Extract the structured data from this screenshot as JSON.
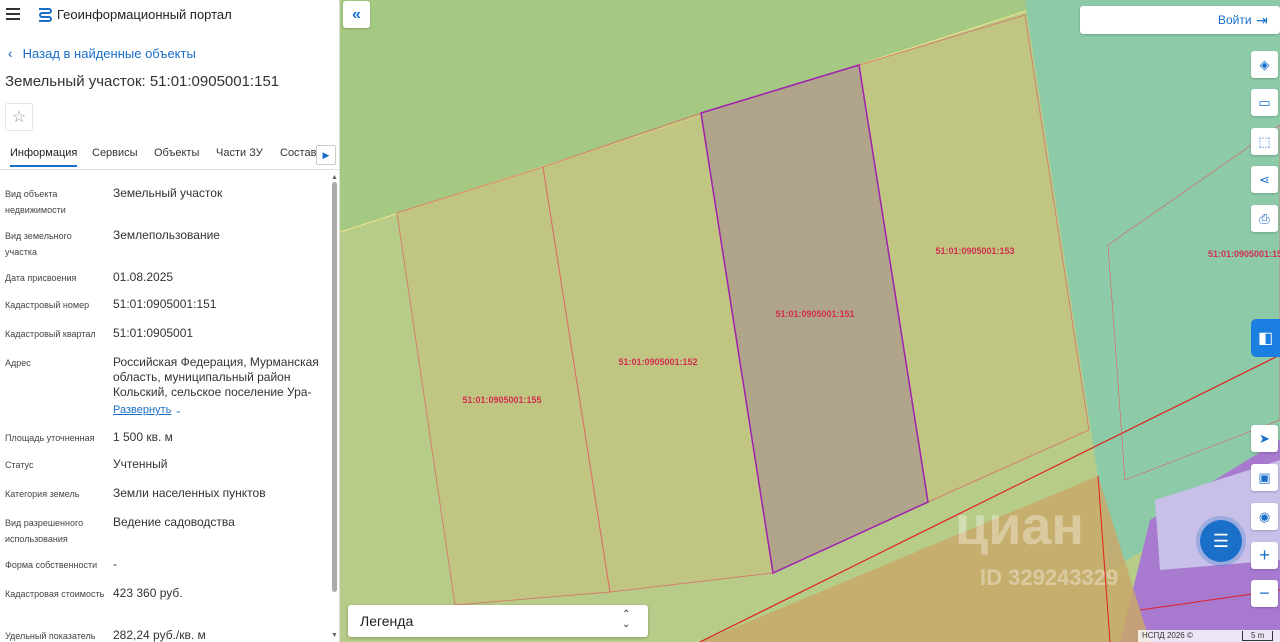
{
  "header": {
    "portal_title": "Геоинформационный портал"
  },
  "nav": {
    "back_label": "Назад в найденные объекты"
  },
  "parcel": {
    "title": "Земельный участок: 51:01:0905001:151"
  },
  "tabs": [
    {
      "label": "Информация",
      "active": true
    },
    {
      "label": "Сервисы"
    },
    {
      "label": "Объекты"
    },
    {
      "label": "Части ЗУ"
    },
    {
      "label": "Состав"
    }
  ],
  "properties": [
    {
      "key": "Вид объекта недвижимости",
      "value": "Земельный участок"
    },
    {
      "key": "Вид земельного участка",
      "value": "Землепользование"
    },
    {
      "key": "Дата присвоения",
      "value": "01.08.2025"
    },
    {
      "key": "Кадастровый номер",
      "value": "51:01:0905001:151"
    },
    {
      "key": "Кадастровый квартал",
      "value": "51:01:0905001"
    },
    {
      "key": "Адрес",
      "value": "Российская Федерация, Мурманская область, муниципальный район Кольский, сельское поселение Ура-"
    },
    {
      "key": "Площадь уточненная",
      "value": "1 500 кв. м"
    },
    {
      "key": "Статус",
      "value": "Учтенный"
    },
    {
      "key": "Категория земель",
      "value": "Земли населенных пунктов"
    },
    {
      "key": "Вид разрешенного использования",
      "value": "Ведение садоводства"
    },
    {
      "key": "Форма собственности",
      "value": "-"
    },
    {
      "key": "Кадастровая стоимость",
      "value": "423 360 руб."
    },
    {
      "key": "Удельный показатель",
      "value": "282,24 руб./кв. м"
    }
  ],
  "address_expand": "Развернуть",
  "map": {
    "login_label": "Войти",
    "legend_label": "Легенда",
    "attribution": "НСПД 2026 ©",
    "scale": "5 m",
    "watermark": "циан",
    "watermark_id": "ID 329243329",
    "parcel_labels": [
      "51:01:0905001:155",
      "51:01:0905001:152",
      "51:01:0905001:151",
      "51:01:0905001:153",
      "51:01:0905001:15"
    ]
  },
  "colors": {
    "accent": "#1a6fc9",
    "selected_parcel_stroke": "#a020b0",
    "parcel_stroke": "#e06060",
    "parcel_label": "#d03050"
  },
  "icons": [
    "hamburger-icon",
    "portal-logo-icon",
    "chevron-left-icon",
    "star-icon",
    "chevron-right-icon",
    "collapse-left-icon",
    "login-icon",
    "layers-icon",
    "ruler-icon",
    "select-area-icon",
    "share-icon",
    "print-icon",
    "badge-icon",
    "locate-icon",
    "minimap-icon",
    "geolocation-icon",
    "zoom-in-icon",
    "zoom-out-icon",
    "chat-icon"
  ]
}
